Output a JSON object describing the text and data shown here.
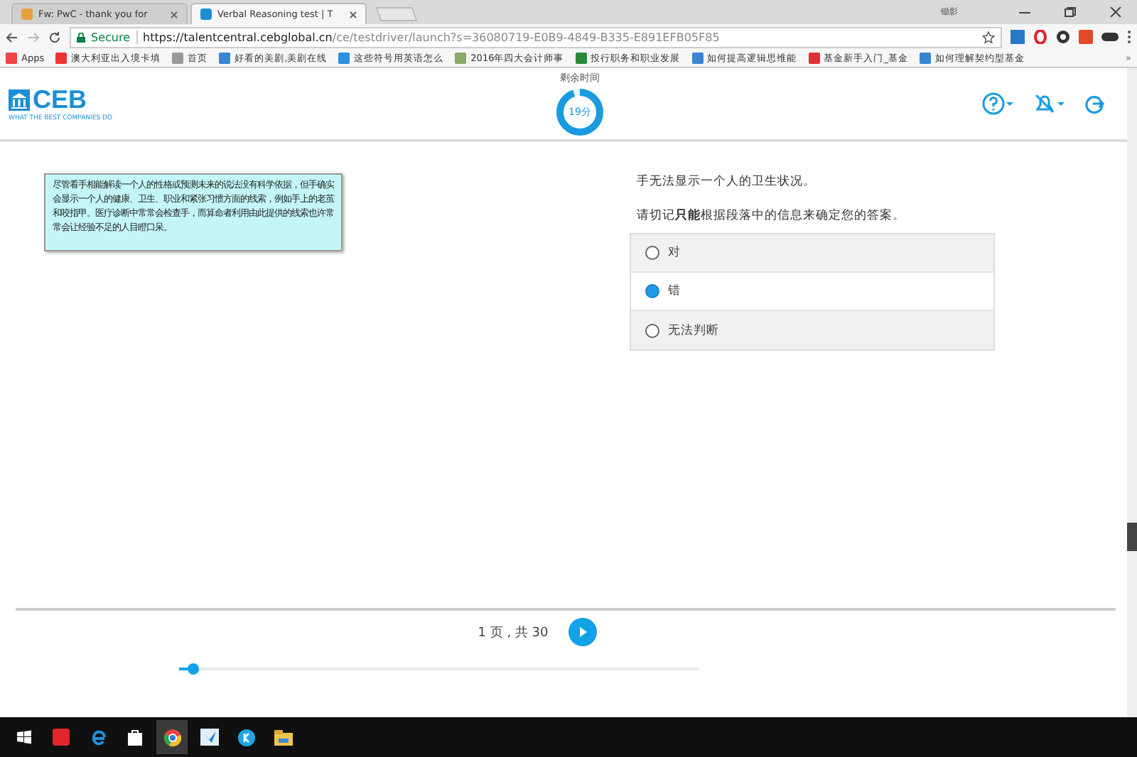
{
  "browser": {
    "tabs": [
      {
        "title": "Fw: PwC - thank you for",
        "selected": false
      },
      {
        "title": "Verbal Reasoning test | T",
        "selected": true
      }
    ],
    "user": "锄影",
    "secure_label": "Secure",
    "url_host": "https://talentcentral.cebglobal.cn",
    "url_path": "/ce/testdriver/launch?s=36080719-E0B9-4849-B335-E891EFB05F85",
    "bookmarks": [
      "Apps",
      "澳大利亚出入境卡填",
      "首页",
      "好看的美剧,美剧在线",
      "这些符号用英语怎么",
      "2016年四大会计师事",
      "投行职务和职业发展",
      "如何提高逻辑思维能",
      "基金新手入门_基金",
      "如何理解契约型基金"
    ],
    "more": "»"
  },
  "header": {
    "logo": "CEB",
    "tagline": "WHAT THE BEST COMPANIES DO",
    "timer_label": "剩余时间",
    "timer_value": "19分",
    "timer_ring": {
      "level": 0.95
    }
  },
  "passage": "尽管看手相能解读一个人的性格或预测未来的说法没有科学依据，但手确实会显示一个人的健康、卫生、职业和紧张习惯方面的线索，例如手上的老茧和咬指甲。医疗诊断中常常会检查手，而算命者利用由此提供的线索也许常常会让经验不足的人目瞪口呆。",
  "question": "手无法显示一个人的卫生状况。",
  "instruction": "请切记**只能**根据段落中的信息来确定您的答案。",
  "options": [
    {
      "label": "对",
      "selected": false
    },
    {
      "label": "错",
      "selected": true
    },
    {
      "label": "无法判断",
      "selected": false
    }
  ],
  "footer": {
    "page": "1 页 , 共 30",
    "level": 0.03
  }
}
